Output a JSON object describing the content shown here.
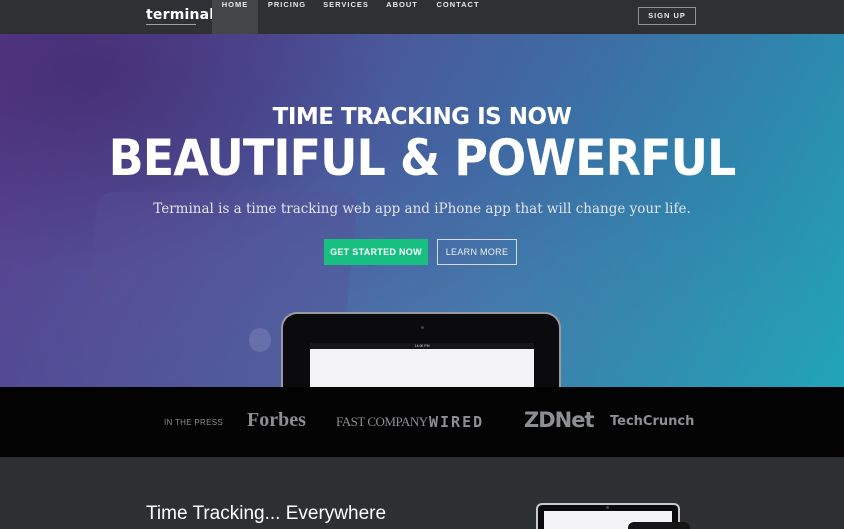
{
  "nav": {
    "logo": "terminal",
    "items": [
      {
        "label": "HOME",
        "active": true
      },
      {
        "label": "PRICING",
        "active": false
      },
      {
        "label": "SERVICES",
        "active": false
      },
      {
        "label": "ABOUT",
        "active": false
      },
      {
        "label": "CONTACT",
        "active": false
      }
    ],
    "signup": "SIGN UP"
  },
  "hero": {
    "title_small": "TIME TRACKING IS NOW",
    "title_big": "BEAUTIFUL & POWERFUL",
    "subtitle": "Terminal is a time tracking web app and iPhone app that will change your life.",
    "primary_button": "GET STARTED NOW",
    "secondary_button": "LEARN MORE",
    "gradient_colors": [
      "#5b3e8e",
      "#3f6aa4",
      "#22a5b8"
    ],
    "device_time": "14:06 PM"
  },
  "press": {
    "label": "IN THE PRESS",
    "logos": [
      "Forbes",
      "FAST COMPANY",
      "WIRED",
      "ZDNet",
      "TechCrunch"
    ]
  },
  "bottom": {
    "title": "Time Tracking... Everywhere"
  },
  "colors": {
    "nav_bg": "#2f3033",
    "nav_active": "#434549",
    "primary": "#17c081",
    "press_bg": "#030304",
    "section_bg": "#2e2f33"
  }
}
